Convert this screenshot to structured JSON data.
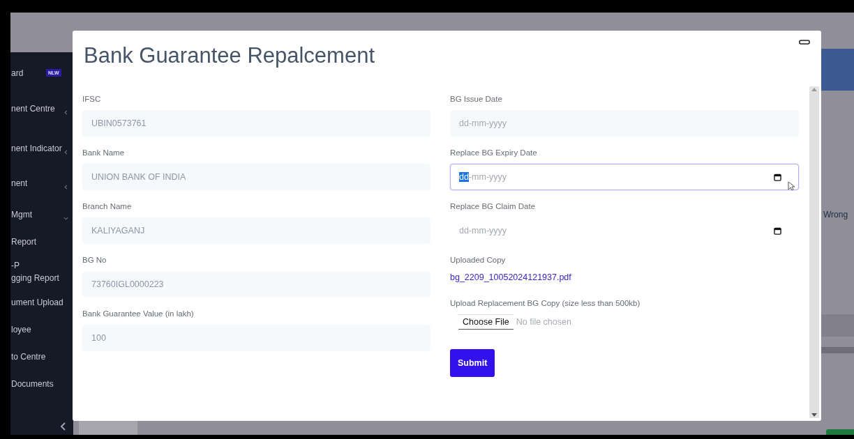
{
  "sidebar": {
    "items": [
      {
        "lines": [
          "ard"
        ],
        "badge": "NLW"
      },
      {
        "lines": [
          "nent Centre"
        ],
        "expanded": false
      },
      {
        "lines": [
          "nent Indicator"
        ],
        "expanded": false
      },
      {
        "lines": [
          "nent"
        ],
        "expanded": false
      },
      {
        "lines": [
          "Mgmt"
        ],
        "expanded": true
      },
      {
        "lines": [
          "Report"
        ]
      },
      {
        "lines": [
          "-P",
          "gging Report"
        ]
      },
      {
        "lines": [
          "ument Upload"
        ]
      },
      {
        "lines": [
          "loyee"
        ]
      },
      {
        "lines": [
          "to Centre"
        ]
      },
      {
        "lines": [
          "Documents"
        ]
      }
    ]
  },
  "side_text": "Wrong",
  "modal": {
    "title": "Bank Guarantee Repalcement",
    "left_fields": [
      {
        "kind": "text",
        "label": "IFSC",
        "value": "UBIN0573761"
      },
      {
        "kind": "text",
        "label": "Bank Name",
        "value": "UNION BANK OF INDIA"
      },
      {
        "kind": "text",
        "label": "Branch Name",
        "value": "KALIYAGANJ"
      },
      {
        "kind": "text",
        "label": "BG No",
        "value": "73760IGL0000223"
      },
      {
        "kind": "text",
        "label": "Bank Guarantee Value (in lakh)",
        "value": "100"
      }
    ],
    "right_fields": [
      {
        "kind": "date",
        "label": "BG Issue Date",
        "readonly": true,
        "focused": false,
        "parts": [
          {
            "text": "dd-mm-yyyy",
            "selected": false
          }
        ]
      },
      {
        "kind": "date",
        "label": "Replace BG Expiry Date",
        "readonly": false,
        "focused": true,
        "parts": [
          {
            "text": "dd",
            "selected": true
          },
          {
            "text": "-mm-yyyy",
            "selected": false
          }
        ]
      },
      {
        "kind": "date",
        "label": "Replace BG Claim Date",
        "readonly": false,
        "focused": false,
        "parts": [
          {
            "text": "dd-mm-yyyy",
            "selected": false
          }
        ]
      },
      {
        "kind": "link",
        "label": "Uploaded Copy",
        "value": "bg_2209_10052024121937.pdf"
      },
      {
        "kind": "file",
        "label": "Upload Replacement BG Copy (size less than 500kb)",
        "button": "Choose File",
        "status": "No file chosen"
      }
    ],
    "submit": "Submit"
  }
}
